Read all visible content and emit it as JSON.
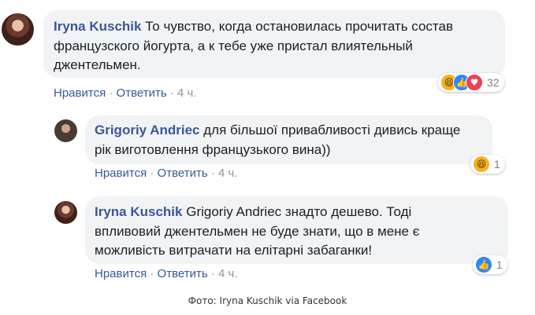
{
  "comments": [
    {
      "author": "Iryna Kuschik",
      "text": "То чувство, когда остановилась прочитать состав французского йогурта, а к тебе уже пристал влиятельный джентельмен.",
      "line1": "То чувство, когда остановилась прочитать состав",
      "line2": "французского йогурта, а к тебе уже пристал влиятельный",
      "line3": "джентельмен.",
      "like_label": "Нравится",
      "reply_label": "Ответить",
      "separator": "·",
      "time": "4 ч.",
      "reactions": [
        "haha",
        "like",
        "love"
      ],
      "reaction_count": "32"
    },
    {
      "author": "Grigoriy Andriec",
      "line1": "для більшої привабливості дивись краще",
      "line2": "рік виготовлення французького вина))",
      "like_label": "Нравится",
      "reply_label": "Ответить",
      "separator": "·",
      "time": "4 ч.",
      "reactions": [
        "haha"
      ],
      "reaction_count": "1"
    },
    {
      "author": "Iryna Kuschik",
      "line1": "Grigoriy Andriec знадто дешево. Тоді",
      "line2": "впливовий джентельмен не буде знати, що в мене є",
      "line3": "можливість витрачати на елітарні забаганки!",
      "like_label": "Нравится",
      "reply_label": "Ответить",
      "separator": "·",
      "time": "4 ч.",
      "reactions": [
        "like"
      ],
      "reaction_count": "1"
    }
  ],
  "caption": "Фото: Iryna Kuschik via Facebook",
  "colors": {
    "author": "#385898",
    "bubble": "#f2f3f5",
    "muted": "#90949c"
  }
}
